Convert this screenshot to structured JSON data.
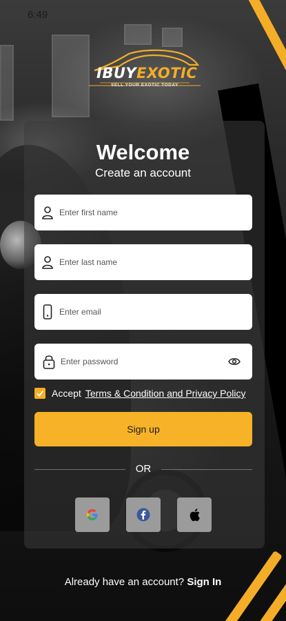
{
  "status_bar": {
    "time": "6:49"
  },
  "logo": {
    "brand_part1": "IBUY",
    "brand_part2": "EXOTIC",
    "tagline": "SELL YOUR EXOTIC TODAY"
  },
  "header": {
    "title": "Welcome",
    "subtitle": "Create an account"
  },
  "form": {
    "first_name": {
      "placeholder": "Enter first name",
      "value": "",
      "icon": "user-icon"
    },
    "last_name": {
      "placeholder": "Enter last name",
      "value": "",
      "icon": "user-icon"
    },
    "email": {
      "placeholder": "Enter email",
      "value": "",
      "icon": "phone-icon"
    },
    "password": {
      "placeholder": "Enter password",
      "value": "",
      "icon": "lock-icon",
      "toggle_icon": "eye-icon"
    }
  },
  "terms": {
    "checked": true,
    "prefix": "Accept",
    "link": "Terms & Condition and Privacy Policy"
  },
  "actions": {
    "signup_label": "Sign up",
    "or_label": "OR"
  },
  "social": [
    {
      "name": "google",
      "icon": "google-icon"
    },
    {
      "name": "facebook",
      "icon": "facebook-icon"
    },
    {
      "name": "apple",
      "icon": "apple-icon"
    }
  ],
  "footer": {
    "prompt": "Already have an account?",
    "signin_label": "Sign In"
  },
  "colors": {
    "accent": "#f4ad26",
    "button": "#f7b228",
    "social_bg": "#9b9b9b",
    "facebook": "#3b5998"
  }
}
